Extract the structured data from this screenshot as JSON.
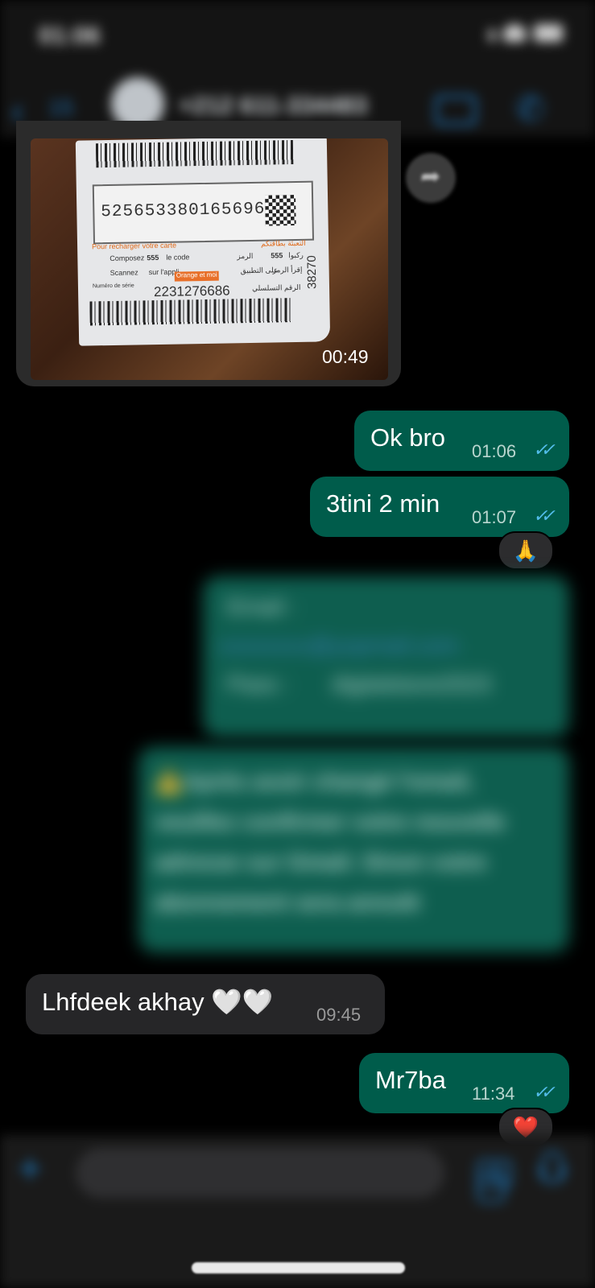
{
  "header": {
    "status_time": "01:06",
    "back_count": "15",
    "contact": "+212 611-334483",
    "icons": [
      "back-chevron-icon",
      "video-call-icon",
      "phone-icon"
    ]
  },
  "image_message": {
    "card_number": "5256533801656962",
    "serial": "2231276686",
    "side_number": "38270",
    "recharge_title": "Pour recharger votre carte",
    "compose_label": "Composez",
    "compose_number": "555",
    "code_label": "le code",
    "scan_label": "Scannez",
    "app_label": "sur l'appli",
    "app_badge": "Orange et moi",
    "serial_label": "Numéro de série",
    "arabic_title": "التعبئة بطاقتكم",
    "arabic_dial": "ركبوا",
    "arabic_code": "الرمز",
    "arabic_scan": "إقرأ الرمز",
    "arabic_app": "على التطبيق",
    "arabic_serial": "الرقم التسلسلي",
    "duration": "00:49"
  },
  "messages": [
    {
      "text": "Ok bro",
      "time": "01:06",
      "direction": "out",
      "read": true
    },
    {
      "text": "3tini 2 min",
      "time": "01:07",
      "direction": "out",
      "read": true,
      "reaction": "🙏"
    },
    {
      "text": "Lhfdeek akhay 🤍🤍",
      "time": "09:45",
      "direction": "in"
    },
    {
      "text": "Mr7ba",
      "time": "11:34",
      "direction": "out",
      "read": true,
      "reaction": "❤️"
    }
  ],
  "blurred": {
    "email_label": "Email :",
    "email_value": "xxxxxxxx@yopmail.com",
    "pass_label": "Pass :",
    "pass_value": "digitalstore2023",
    "notice": "⚠️Après avoir changé l'email, veuillez confirmer votre nouvelle adresse sur Gmail. Sinon votre abonnement sera annulé"
  },
  "composer": {
    "icons": [
      "plus-icon",
      "sticker-icon",
      "camera-icon",
      "microphone-icon"
    ]
  },
  "colors": {
    "outgoing": "#005c4b",
    "incoming": "#262628",
    "accent": "#1d74b5",
    "read_ticks": "#53bdeb"
  }
}
